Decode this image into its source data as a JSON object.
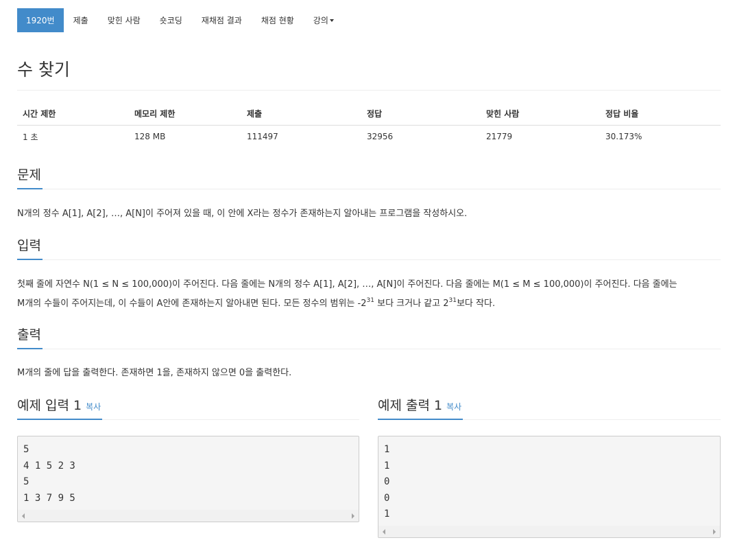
{
  "nav": {
    "items": [
      "1920번",
      "제출",
      "맞힌 사람",
      "숏코딩",
      "재채점 결과",
      "채점 현황"
    ],
    "dropdown_label": "강의"
  },
  "title": "수 찾기",
  "info": {
    "headers": [
      "시간 제한",
      "메모리 제한",
      "제출",
      "정답",
      "맞힌 사람",
      "정답 비율"
    ],
    "values": [
      "1 초",
      "128 MB",
      "111497",
      "32956",
      "21779",
      "30.173%"
    ]
  },
  "problem": {
    "heading": "문제",
    "text": "N개의 정수 A[1], A[2], …, A[N]이 주어져 있을 때, 이 안에 X라는 정수가 존재하는지 알아내는 프로그램을 작성하시오."
  },
  "input": {
    "heading": "입력",
    "line1": "첫째 줄에 자연수 N(1 ≤ N ≤ 100,000)이 주어진다. 다음 줄에는 N개의 정수 A[1], A[2], …, A[N]이 주어진다. 다음 줄에는 M(1 ≤ M ≤ 100,000)이 주어진다. 다음 줄에는",
    "line2_a": "M개의 수들이 주어지는데, 이 수들이 A안에 존재하는지 알아내면 된다. 모든 정수의 범위는 -2",
    "exp1": "31",
    "line2_b": " 보다 크거나 같고 2",
    "exp2": "31",
    "line2_c": "보다 작다."
  },
  "output": {
    "heading": "출력",
    "text": "M개의 줄에 답을 출력한다. 존재하면 1을, 존재하지 않으면 0을 출력한다."
  },
  "sample_input": {
    "heading": "예제 입력 1",
    "copy_label": "복사",
    "content": "5\n4 1 5 2 3\n5\n1 3 7 9 5"
  },
  "sample_output": {
    "heading": "예제 출력 1",
    "copy_label": "복사",
    "content": "1\n1\n0\n0\n1"
  },
  "colors": {
    "accent": "#428bca",
    "pre_bg": "#f5f5f5"
  }
}
